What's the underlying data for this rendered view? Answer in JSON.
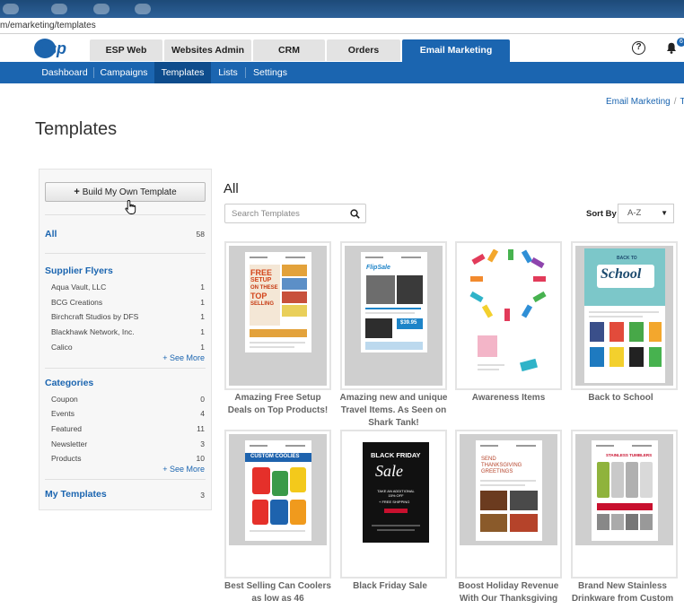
{
  "browser": {
    "url": "m/emarketing/templates"
  },
  "topnav": {
    "logo": "esp",
    "tabs": [
      {
        "label": "ESP Web"
      },
      {
        "label": "Websites Admin"
      },
      {
        "label": "CRM"
      },
      {
        "label": "Orders"
      },
      {
        "label": "Email Marketing"
      }
    ],
    "help_icon": "question-circle-icon",
    "bell_icon": "bell-icon",
    "badge": "6"
  },
  "subnav": {
    "items": [
      {
        "label": "Dashboard"
      },
      {
        "label": "Campaigns"
      },
      {
        "label": "Templates"
      },
      {
        "label": "Lists"
      },
      {
        "label": "Settings"
      }
    ]
  },
  "breadcrumb": {
    "link": "Email Marketing",
    "sep": "/",
    "current": "T"
  },
  "page": {
    "title": "Templates"
  },
  "sidebar": {
    "build_button": "Build My Own Template",
    "build_icon": "+",
    "all_label": "All",
    "all_count": "58",
    "supplier_title": "Supplier Flyers",
    "suppliers": [
      {
        "name": "Aqua Vault, LLC",
        "count": "1"
      },
      {
        "name": "BCG Creations",
        "count": "1"
      },
      {
        "name": "Birchcraft Studios by DFS",
        "count": "1"
      },
      {
        "name": "Blackhawk Network, Inc.",
        "count": "1"
      },
      {
        "name": "Calico",
        "count": "1"
      }
    ],
    "see_more": "+ See More",
    "categories_title": "Categories",
    "categories": [
      {
        "name": "Coupon",
        "count": "0"
      },
      {
        "name": "Events",
        "count": "4"
      },
      {
        "name": "Featured",
        "count": "11"
      },
      {
        "name": "Newsletter",
        "count": "3"
      },
      {
        "name": "Products",
        "count": "10"
      }
    ],
    "my_templates_label": "My Templates",
    "my_templates_count": "3"
  },
  "main": {
    "heading": "All",
    "search_placeholder": "Search Templates",
    "sort_label": "Sort By",
    "sort_value": "A-Z",
    "templates": [
      {
        "title": "Amazing Free Setup Deals on Top Products!",
        "thumb_text_1": "FREE",
        "thumb_text_2": "SETUP",
        "thumb_text_3": "ON THESE",
        "thumb_text_4": "TOP",
        "thumb_text_5": "SELLING"
      },
      {
        "title": "Amazing new and unique Travel Items. As Seen on Shark Tank!",
        "thumb_text_1": "FlipSale",
        "thumb_text_2": "$39.95"
      },
      {
        "title": "Awareness Items"
      },
      {
        "title": "Back to School",
        "thumb_text_1": "BACK TO",
        "thumb_text_2": "School"
      },
      {
        "title": "Best Selling Can Coolers as low as 46",
        "thumb_text_1": "CUSTOM COOLIES"
      },
      {
        "title": "Black Friday Sale",
        "thumb_text_1": "BLACK FRIDAY",
        "thumb_text_2": "Sale",
        "thumb_text_3": "TAKE AN ADDITIONAL 15% OFF",
        "thumb_text_4": "+ FREE SHIPPING"
      },
      {
        "title": "Boost Holiday Revenue With Our Thanksgiving",
        "thumb_text_1": "SEND",
        "thumb_text_2": "THANKSGIVING",
        "thumb_text_3": "GREETINGS"
      },
      {
        "title": "Brand New Stainless Drinkware from Custom",
        "thumb_text_1": "STAINLESS TUMBLERS"
      }
    ]
  },
  "colors": {
    "brand_blue": "#1b65b0",
    "subnav_active": "#0e4c8c"
  }
}
